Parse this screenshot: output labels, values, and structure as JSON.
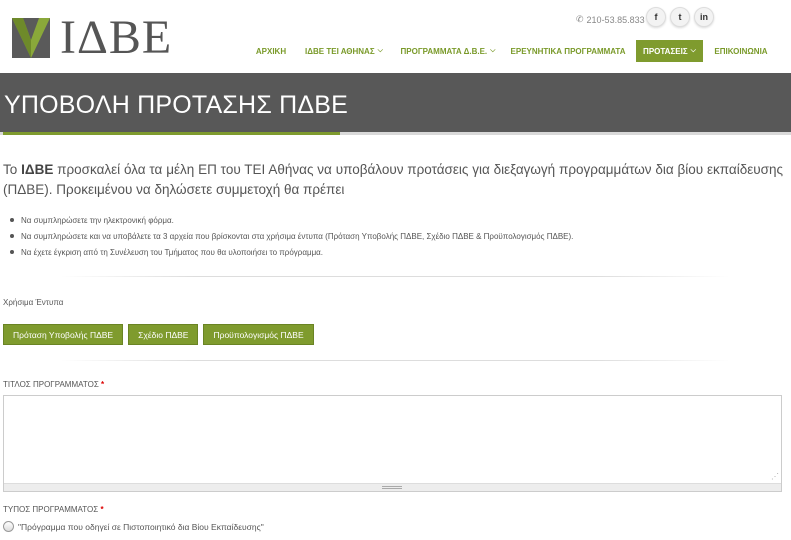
{
  "brand": {
    "logo_text": "ΙΔΒΕ",
    "accent": "#7f9b2e"
  },
  "header": {
    "phone": "210-53.85.833",
    "social": [
      {
        "icon": "facebook-icon",
        "glyph": "f"
      },
      {
        "icon": "twitter-icon",
        "glyph": "t"
      },
      {
        "icon": "linkedin-icon",
        "glyph": "in"
      }
    ]
  },
  "nav": {
    "items": [
      {
        "label": "ΑΡΧΙΚΗ",
        "dropdown": false,
        "active": false
      },
      {
        "label": "ΙΔΒΕ ΤΕΙ ΑΘΗΝΑΣ",
        "dropdown": true,
        "active": false
      },
      {
        "label": "ΠΡΟΓΡΑΜΜΑΤΑ Δ.Β.Ε.",
        "dropdown": true,
        "active": false
      },
      {
        "label": "ΕΡΕΥΝΗΤΙΚΑ ΠΡΟΓΡΑΜΜΑΤΑ",
        "dropdown": false,
        "active": false
      },
      {
        "label": "ΠΡΟΤΑΣΕΙΣ",
        "dropdown": true,
        "active": true
      },
      {
        "label": "ΕΠΙΚΟΙΝΩΝΙΑ",
        "dropdown": false,
        "active": false
      }
    ]
  },
  "page": {
    "title": "ΥΠΟΒΟΛΗ ΠΡΟΤΑΣΗΣ ΠΔΒΕ"
  },
  "intro": {
    "prefix": "Το ",
    "org": "ΙΔΒΕ",
    "text": " προσκαλεί όλα τα μέλη ΕΠ του ΤΕΙ Αθήνας να υποβάλουν προτάσεις για διεξαγωγή προγραμμάτων δια βίου εκπαίδευσης (ΠΔΒΕ). Προκειμένου να δηλώσετε συμμετοχή θα πρέπει"
  },
  "bullets": [
    "Να συμπληρώσετε την ηλεκτρονική φόρμα.",
    "Να συμπληρώσετε και να υποβάλετε τα 3 αρχεία που βρίσκονται στα χρήσιμα έντυπα (Πρόταση Υποβολής ΠΔΒΕ, Σχέδιο ΠΔΒΕ & Προϋπολογισμός ΠΔΒΕ).",
    "Να έχετε έγκριση από τη Συνέλευση του Τμήματος που θα υλοποιήσει το πρόγραμμα."
  ],
  "forms": {
    "label": "Χρήσιμα Έντυπα",
    "buttons": [
      "Πρόταση Υποβολής ΠΔΒΕ",
      "Σχέδιο ΠΔΒΕ",
      "Προϋπολογισμός ΠΔΒΕ"
    ]
  },
  "fields": {
    "title_label": "ΤΙΤΛΟΣ ΠΡΟΓΡΑΜΜΑΤΟΣ",
    "title_value": "",
    "type_label": "ΤΥΠΟΣ ΠΡΟΓΡΑΜΜΑΤΟΣ",
    "required_mark": "*",
    "type_options": [
      "\"Πρόγραμμα που οδηγεί σε Πιστοποιητικό δια Βίου Εκπαίδευσης\""
    ]
  }
}
